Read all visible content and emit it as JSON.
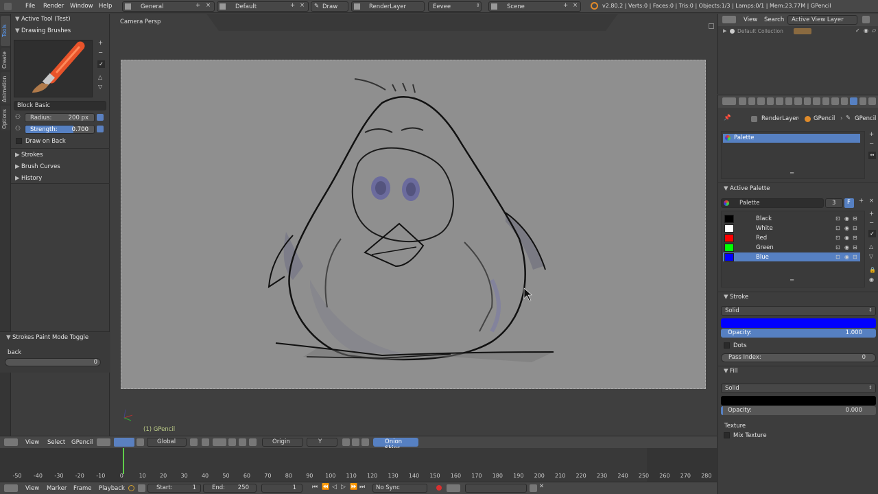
{
  "topbar": {
    "menus": [
      "File",
      "Render",
      "Window",
      "Help"
    ],
    "screen_layout": "General",
    "scene_layout": "Default",
    "mode": "Draw",
    "render_layer": "RenderLayer",
    "engine": "Eevee",
    "scene": "Scene",
    "stats": "v2.80.2 | Verts:0 | Faces:0 | Tris:0 | Objects:1/3 | Lamps:0/1 | Mem:23.77M | GPencil"
  },
  "toolshelf": {
    "vertical_tabs": [
      "Tools",
      "Create",
      "Animation",
      "Options"
    ],
    "active_tool_label": "Active Tool (Test)",
    "drawing_brushes_label": "Drawing Brushes",
    "brush_name": "Block Basic",
    "radius_label": "Radius:",
    "radius_value": "200 px",
    "strength_label": "Strength:",
    "strength_value": "0.700",
    "draw_on_back_label": "Draw on Back",
    "sections": [
      "Strokes",
      "Brush Curves",
      "History"
    ],
    "operator_title": "Strokes Paint Mode Toggle",
    "operator_field_label": "back",
    "operator_field_value": "0"
  },
  "viewport": {
    "view_name": "Camera Persp",
    "object_label": "(1) GPencil",
    "header_menus": [
      "View",
      "Select",
      "GPencil"
    ],
    "orientation": "Global",
    "pivot": "Origin",
    "axis": "Y",
    "onion_skins": "Onion Skins"
  },
  "timeline": {
    "ticks": [
      "-50",
      "-40",
      "-30",
      "-20",
      "-10",
      "0",
      "10",
      "20",
      "30",
      "40",
      "50",
      "60",
      "70",
      "80",
      "90",
      "100",
      "110",
      "120",
      "130",
      "140",
      "150",
      "160",
      "170",
      "180",
      "190",
      "200",
      "210",
      "220",
      "230",
      "240",
      "250",
      "260",
      "270",
      "280"
    ],
    "menus": [
      "View",
      "Marker",
      "Frame",
      "Playback"
    ],
    "start_label": "Start:",
    "start_value": "1",
    "end_label": "End:",
    "end_value": "250",
    "current_frame": "1",
    "sync": "No Sync"
  },
  "outliner": {
    "menus": [
      "View",
      "Search"
    ],
    "layer_dropdown": "Active View Layer",
    "collection": "Default Collection"
  },
  "properties": {
    "breadcrumb": [
      "RenderLayer",
      "GPencil",
      "GPencil"
    ],
    "palette_slot": "Palette",
    "active_palette_header": "Active Palette",
    "palette_name": "Palette",
    "palette_users": "3",
    "palette_fake": "F",
    "colors": [
      {
        "name": "Black",
        "hex": "#000000"
      },
      {
        "name": "White",
        "hex": "#ffffff"
      },
      {
        "name": "Red",
        "hex": "#ff0000"
      },
      {
        "name": "Green",
        "hex": "#00ff00"
      },
      {
        "name": "Blue",
        "hex": "#0000ff"
      }
    ],
    "active_color_index": 4,
    "stroke_header": "Stroke",
    "stroke_mode": "Solid",
    "stroke_color": "#0000ff",
    "stroke_opacity_label": "Opacity:",
    "stroke_opacity_value": "1.000",
    "dots_label": "Dots",
    "pass_index_label": "Pass Index:",
    "pass_index_value": "0",
    "fill_header": "Fill",
    "fill_mode": "Solid",
    "fill_color": "#000000",
    "fill_opacity_label": "Opacity:",
    "fill_opacity_value": "0.000",
    "texture_label": "Texture",
    "mix_texture_label": "Mix Texture"
  }
}
